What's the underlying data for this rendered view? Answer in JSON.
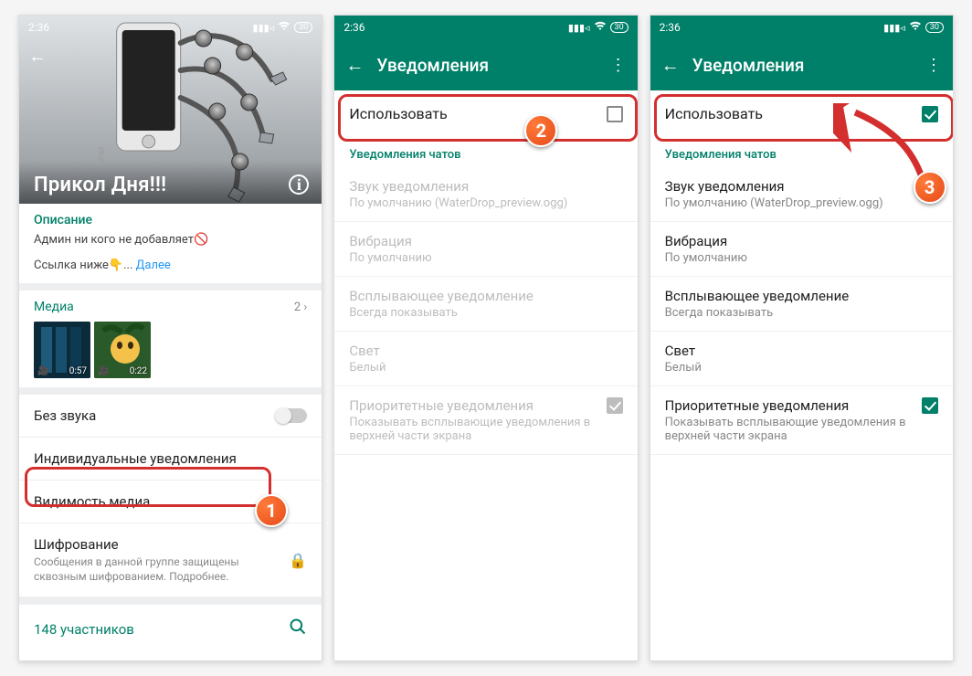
{
  "status": {
    "time": "2:36",
    "battery": "30"
  },
  "screen1": {
    "group_title": "Прикол Дня!!!",
    "description_label": "Описание",
    "description_line1": "Админ ни кого не добавляет🚫",
    "description_line2_prefix": "Ссылка ниже👇... ",
    "more": "Далее",
    "media_label": "Медиа",
    "media_count": "2",
    "thumb1_duration": "0:57",
    "thumb2_duration": "0:22",
    "mute_label": "Без звука",
    "custom_notif_label": "Индивидуальные уведомления",
    "media_visibility_label": "Видимость медиа",
    "encryption_title": "Шифрование",
    "encryption_sub": "Сообщения в данной группе защищены сквозным шифрованием. Подробнее.",
    "participants": "148 участников"
  },
  "notif": {
    "title": "Уведомления",
    "use_label": "Использовать",
    "section_header": "Уведомления чатов",
    "sound_title": "Звук уведомления",
    "sound_sub": "По умолчанию (WaterDrop_preview.ogg)",
    "vibration_title": "Вибрация",
    "vibration_sub": "По умолчанию",
    "popup_title": "Всплывающее уведомление",
    "popup_sub": "Всегда показывать",
    "light_title": "Свет",
    "light_sub": "Белый",
    "priority_title": "Приоритетные уведомления",
    "priority_sub": "Показывать всплывающие уведомления в верхней части экрана"
  },
  "badges": {
    "b1": "1",
    "b2": "2",
    "b3": "3"
  }
}
